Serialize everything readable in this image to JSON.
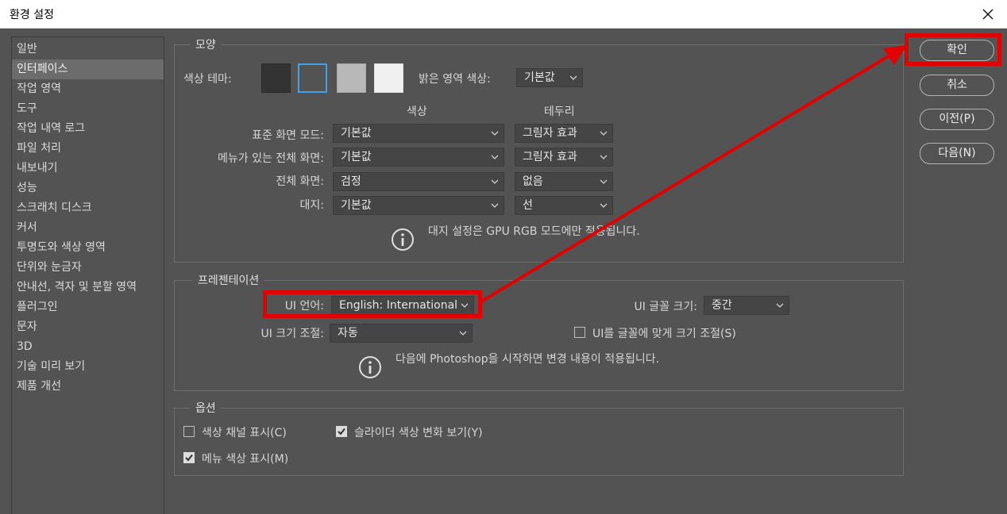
{
  "window": {
    "title": "환경 설정"
  },
  "sidebar": {
    "items": [
      {
        "label": "일반"
      },
      {
        "label": "인터페이스"
      },
      {
        "label": "작업 영역"
      },
      {
        "label": "도구"
      },
      {
        "label": "작업 내역 로그"
      },
      {
        "label": "파일 처리"
      },
      {
        "label": "내보내기"
      },
      {
        "label": "성능"
      },
      {
        "label": "스크래치 디스크"
      },
      {
        "label": "커서"
      },
      {
        "label": "투명도와 색상 영역"
      },
      {
        "label": "단위와 눈금자"
      },
      {
        "label": "안내선, 격자 및 분할 영역"
      },
      {
        "label": "플러그인"
      },
      {
        "label": "문자"
      },
      {
        "label": "3D"
      },
      {
        "label": "기술 미리 보기"
      },
      {
        "label": "제품 개선"
      }
    ],
    "selected": "인터페이스"
  },
  "appearance": {
    "title": "모양",
    "color_theme_label": "색상 테마:",
    "themes": [
      "#333333",
      "#535353",
      "#b8b8b8",
      "#f0f0f0"
    ],
    "selected_theme_index": 1,
    "highlight_color_label": "밝은 영역 색상:",
    "highlight_color_value": "기본값",
    "col_color": "색상",
    "col_border": "테두리",
    "rows": [
      {
        "label": "표준 화면 모드:",
        "color": "기본값",
        "border": "그림자 효과"
      },
      {
        "label": "메뉴가 있는 전체 화면:",
        "color": "기본값",
        "border": "그림자 효과"
      },
      {
        "label": "전체 화면:",
        "color": "검정",
        "border": "없음"
      },
      {
        "label": "대지:",
        "color": "기본값",
        "border": "선"
      }
    ],
    "note": "대지 설정은 GPU RGB 모드에만 적용됩니다."
  },
  "presentation": {
    "title": "프레젠테이션",
    "ui_language_label": "UI 언어:",
    "ui_language_value": "English: International",
    "ui_font_size_label": "UI 글꼴 크기:",
    "ui_font_size_value": "중간",
    "ui_scaling_label": "UI 크기 조절:",
    "ui_scaling_value": "자동",
    "scale_to_font_label": "UI를 글꼴에 맞게 크기 조절(S)",
    "scale_to_font_checked": false,
    "note": "다음에 Photoshop을 시작하면 변경 내용이 적용됩니다."
  },
  "options": {
    "title": "옵션",
    "show_channels_label": "색상 채널 표시(C)",
    "show_channels_checked": false,
    "slider_color_label": "슬라이더 색상 변화 보기(Y)",
    "slider_color_checked": true,
    "menu_colors_label": "메뉴 색상 표시(M)",
    "menu_colors_checked": true
  },
  "buttons": {
    "ok": "확인",
    "cancel": "취소",
    "prev": "이전(P)",
    "next": "다음(N)"
  },
  "annotation": {
    "color": "#e30000"
  }
}
